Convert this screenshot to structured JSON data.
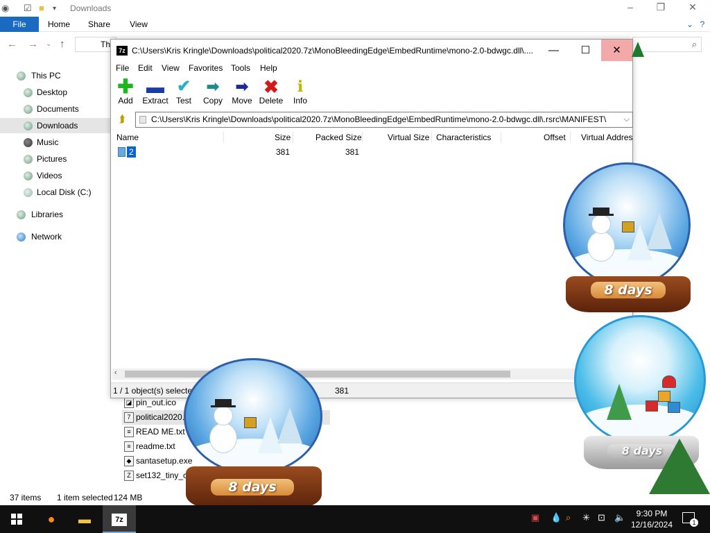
{
  "explorer": {
    "title": "Downloads",
    "ribbon_tabs": [
      "File",
      "Home",
      "Share",
      "View"
    ],
    "address_text": "Th",
    "nav": {
      "this_pc": "This PC",
      "desktop": "Desktop",
      "documents": "Documents",
      "downloads": "Downloads",
      "music": "Music",
      "pictures": "Pictures",
      "videos": "Videos",
      "local_disk": "Local Disk (C:)",
      "libraries": "Libraries",
      "network": "Network"
    },
    "files": [
      {
        "name": "pin_out.ico"
      },
      {
        "name": "political2020."
      },
      {
        "name": "READ ME.txt"
      },
      {
        "name": "readme.txt"
      },
      {
        "name": "santasetup.exe"
      },
      {
        "name": "set132_tiny_chri"
      }
    ],
    "status": {
      "items": "37 items",
      "selected": "1 item selected",
      "size": "124 MB"
    }
  },
  "sevenzip": {
    "app_icon": "7z",
    "title": "C:\\Users\\Kris Kringle\\Downloads\\political2020.7z\\MonoBleedingEdge\\EmbedRuntime\\mono-2.0-bdwgc.dll\\....",
    "menu": [
      "File",
      "Edit",
      "View",
      "Favorites",
      "Tools",
      "Help"
    ],
    "toolbar": [
      {
        "label": "Add",
        "icon": "add-icon",
        "color": "#1fb51f"
      },
      {
        "label": "Extract",
        "icon": "extract-icon",
        "color": "#1a3aa8"
      },
      {
        "label": "Test",
        "icon": "test-icon",
        "color": "#28b0c8"
      },
      {
        "label": "Copy",
        "icon": "copy-icon",
        "color": "#1e8a8a"
      },
      {
        "label": "Move",
        "icon": "move-icon",
        "color": "#1a2a9a"
      },
      {
        "label": "Delete",
        "icon": "delete-icon",
        "color": "#d21a1a"
      },
      {
        "label": "Info",
        "icon": "info-icon",
        "color": "#c9b000"
      }
    ],
    "path": "C:\\Users\\Kris Kringle\\Downloads\\political2020.7z\\MonoBleedingEdge\\EmbedRuntime\\mono-2.0-bdwgc.dll\\.rsrc\\MANIFEST\\",
    "columns": [
      "Name",
      "Size",
      "Packed Size",
      "Virtual Size",
      "Characteristics",
      "Offset",
      "Virtual Addres"
    ],
    "rows": [
      {
        "name": "2",
        "size": "381",
        "packed_size": "381"
      }
    ],
    "status": {
      "selection": "1 / 1 object(s) selected",
      "size": "381"
    }
  },
  "globes": {
    "label": "8 days"
  },
  "taskbar": {
    "time": "9:30 PM",
    "date": "12/16/2024",
    "notification_count": "1"
  }
}
